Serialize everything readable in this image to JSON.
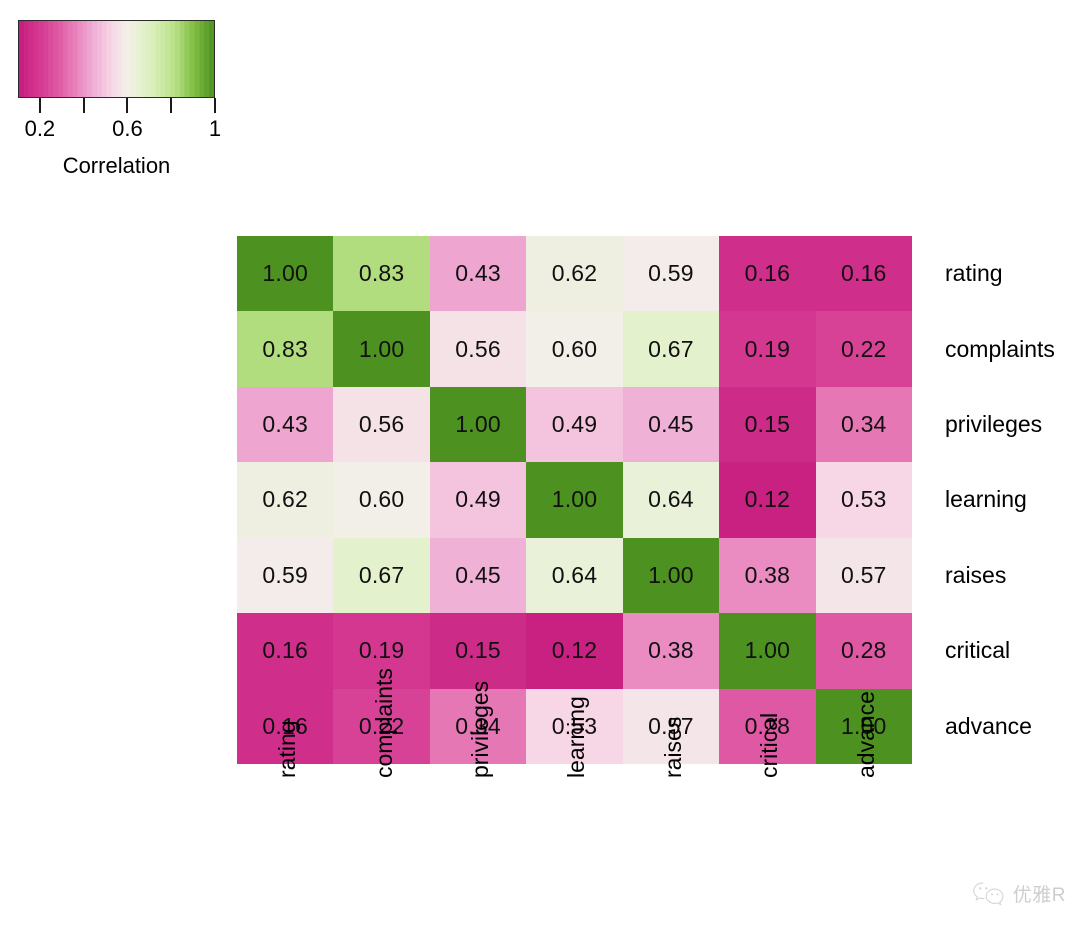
{
  "legend": {
    "title": "Correlation",
    "tick_values": [
      0.2,
      0.4,
      0.6,
      0.8,
      1.0
    ],
    "tick_labels": [
      "0.2",
      "",
      "0.6",
      "",
      "1"
    ],
    "scale_min": 0.1,
    "scale_max": 1.0,
    "color_low": "#C4207E",
    "color_mid": "#F7F7F7",
    "color_high": "#4E9B2E"
  },
  "watermark": {
    "text": "优雅R",
    "logo": "wechat-icon"
  },
  "chart_data": {
    "type": "heatmap",
    "title": "",
    "xlabel": "",
    "ylabel": "",
    "colorbar_label": "Correlation",
    "colorbar_range": [
      0.1,
      1.0
    ],
    "grid": false,
    "legend_position": "top-left",
    "x_categories": [
      "rating",
      "complaints",
      "privileges",
      "learning",
      "raises",
      "critical",
      "advance"
    ],
    "y_categories": [
      "rating",
      "complaints",
      "privileges",
      "learning",
      "raises",
      "critical",
      "advance"
    ],
    "values": [
      [
        1.0,
        0.83,
        0.43,
        0.62,
        0.59,
        0.16,
        0.16
      ],
      [
        0.83,
        1.0,
        0.56,
        0.6,
        0.67,
        0.19,
        0.22
      ],
      [
        0.43,
        0.56,
        1.0,
        0.49,
        0.45,
        0.15,
        0.34
      ],
      [
        0.62,
        0.6,
        0.49,
        1.0,
        0.64,
        0.12,
        0.53
      ],
      [
        0.59,
        0.67,
        0.45,
        0.64,
        1.0,
        0.38,
        0.57
      ],
      [
        0.16,
        0.19,
        0.15,
        0.12,
        0.38,
        1.0,
        0.28
      ],
      [
        0.16,
        0.22,
        0.34,
        0.53,
        0.57,
        0.28,
        1.0
      ]
    ],
    "labels": [
      [
        "1.00",
        "0.83",
        "0.43",
        "0.62",
        "0.59",
        "0.16",
        "0.16"
      ],
      [
        "0.83",
        "1.00",
        "0.56",
        "0.60",
        "0.67",
        "0.19",
        "0.22"
      ],
      [
        "0.43",
        "0.56",
        "1.00",
        "0.49",
        "0.45",
        "0.15",
        "0.34"
      ],
      [
        "0.62",
        "0.60",
        "0.49",
        "1.00",
        "0.64",
        "0.12",
        "0.53"
      ],
      [
        "0.59",
        "0.67",
        "0.45",
        "0.64",
        "1.00",
        "0.38",
        "0.57"
      ],
      [
        "0.16",
        "0.19",
        "0.15",
        "0.12",
        "0.38",
        "1.00",
        "0.28"
      ],
      [
        "0.16",
        "0.22",
        "0.34",
        "0.53",
        "0.57",
        "0.28",
        "1.00"
      ]
    ]
  }
}
